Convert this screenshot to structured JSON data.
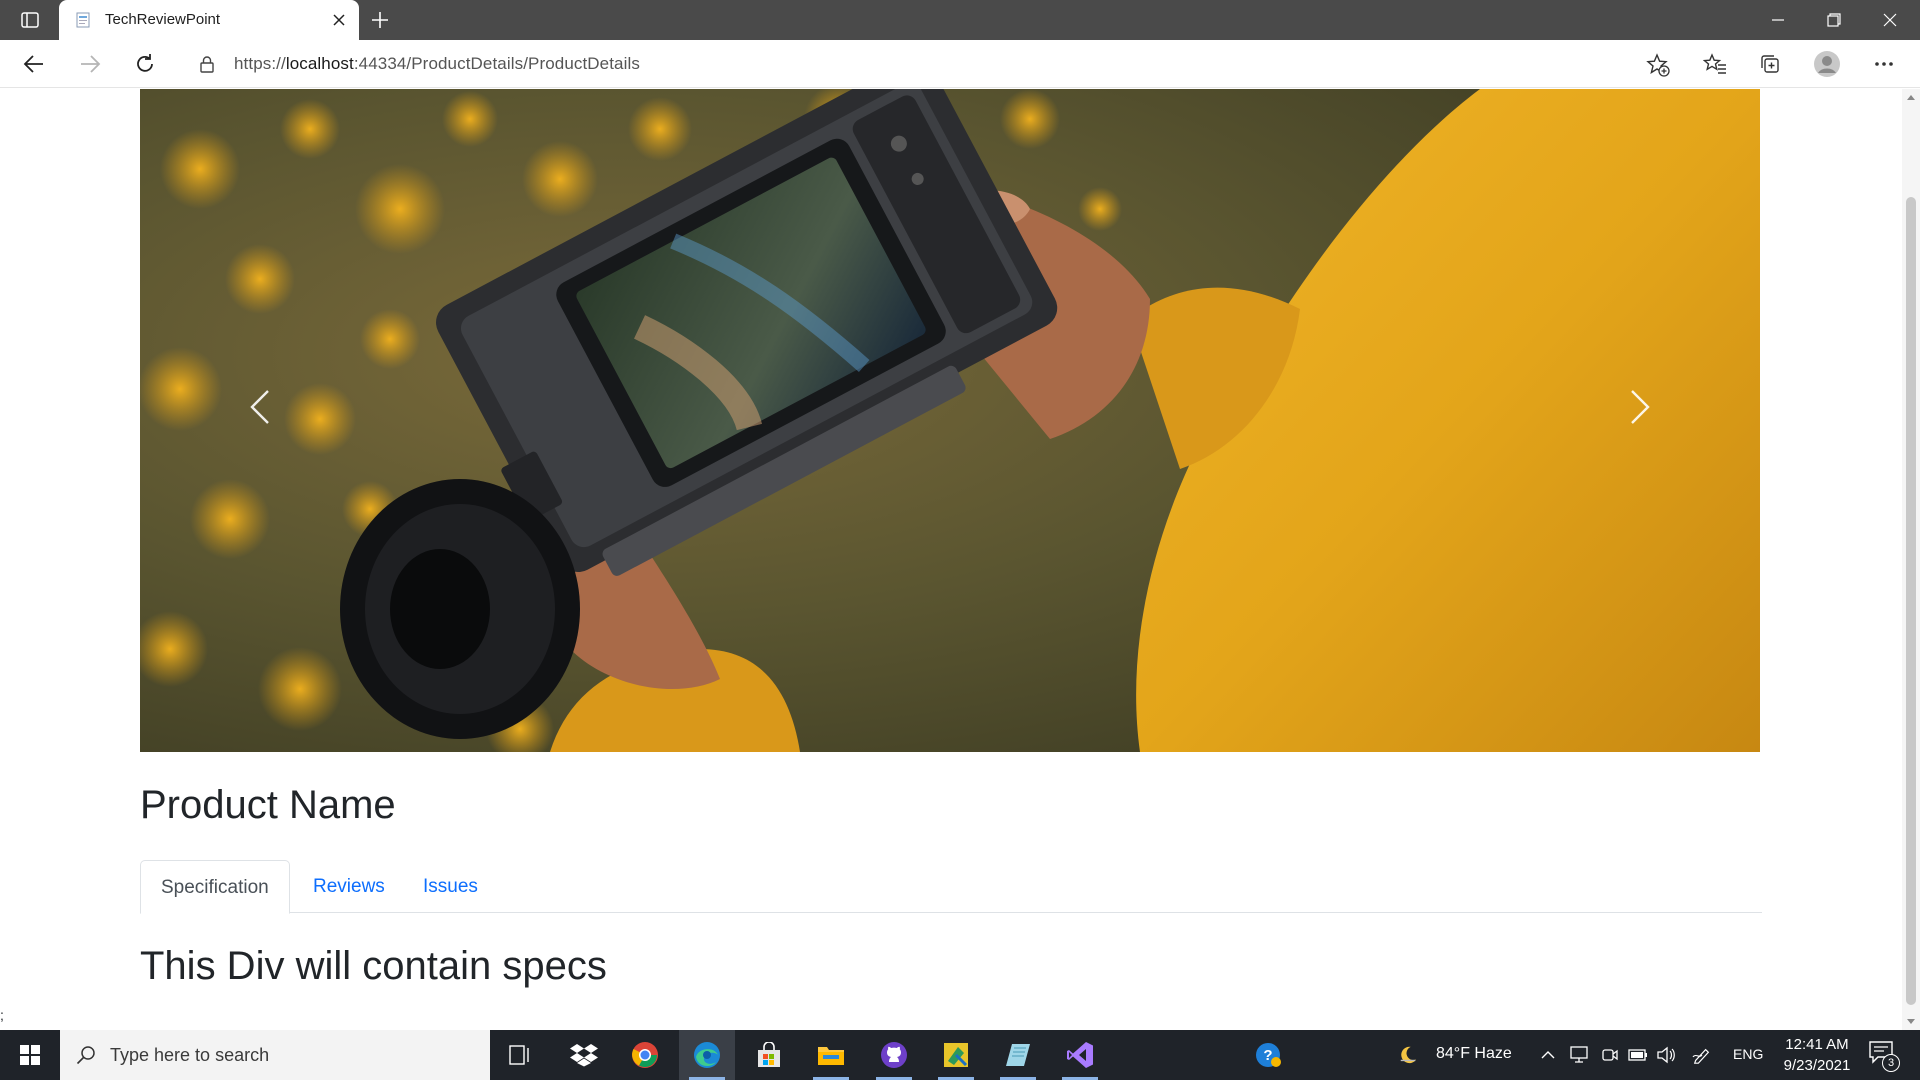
{
  "browser": {
    "tab_title": "TechReviewPoint",
    "url_prefix": "https://",
    "url_host": "localhost",
    "url_rest": ":44334/ProductDetails/ProductDetails",
    "icons": [
      "tab-actions-icon",
      "page-favicon",
      "close-icon",
      "plus-icon",
      "minimize-icon",
      "restore-icon",
      "close-window-icon",
      "back-arrow-icon",
      "forward-arrow-icon",
      "refresh-icon",
      "lock-icon",
      "add-favorite-icon",
      "favorites-icon",
      "collections-icon",
      "profile-icon",
      "more-icon"
    ]
  },
  "page": {
    "product_title": "Product Name",
    "tabs": [
      {
        "label": "Specification",
        "active": true
      },
      {
        "label": "Reviews",
        "active": false
      },
      {
        "label": "Issues",
        "active": false
      }
    ],
    "spec_heading": "This Div will contain specs",
    "stray_text": ";",
    "carousel": {
      "prev_icon": "chevron-left-icon",
      "next_icon": "chevron-right-icon"
    }
  },
  "taskbar": {
    "search_placeholder": "Type here to search",
    "apps": [
      "task-view-icon",
      "dropbox-icon",
      "chrome-icon",
      "edge-icon",
      "store-icon",
      "file-explorer-icon",
      "github-icon",
      "sketch-app-icon",
      "notes-app-icon",
      "visual-studio-icon"
    ],
    "weather": "84°F  Haze",
    "language": "ENG",
    "time": "12:41 AM",
    "date": "9/23/2021",
    "notification_count": "3"
  },
  "colors": {
    "link": "#0d6efd",
    "tabbar": "#4a4a4a",
    "taskbar": "#1f2329",
    "photo_jacket": "#e3a51a"
  }
}
